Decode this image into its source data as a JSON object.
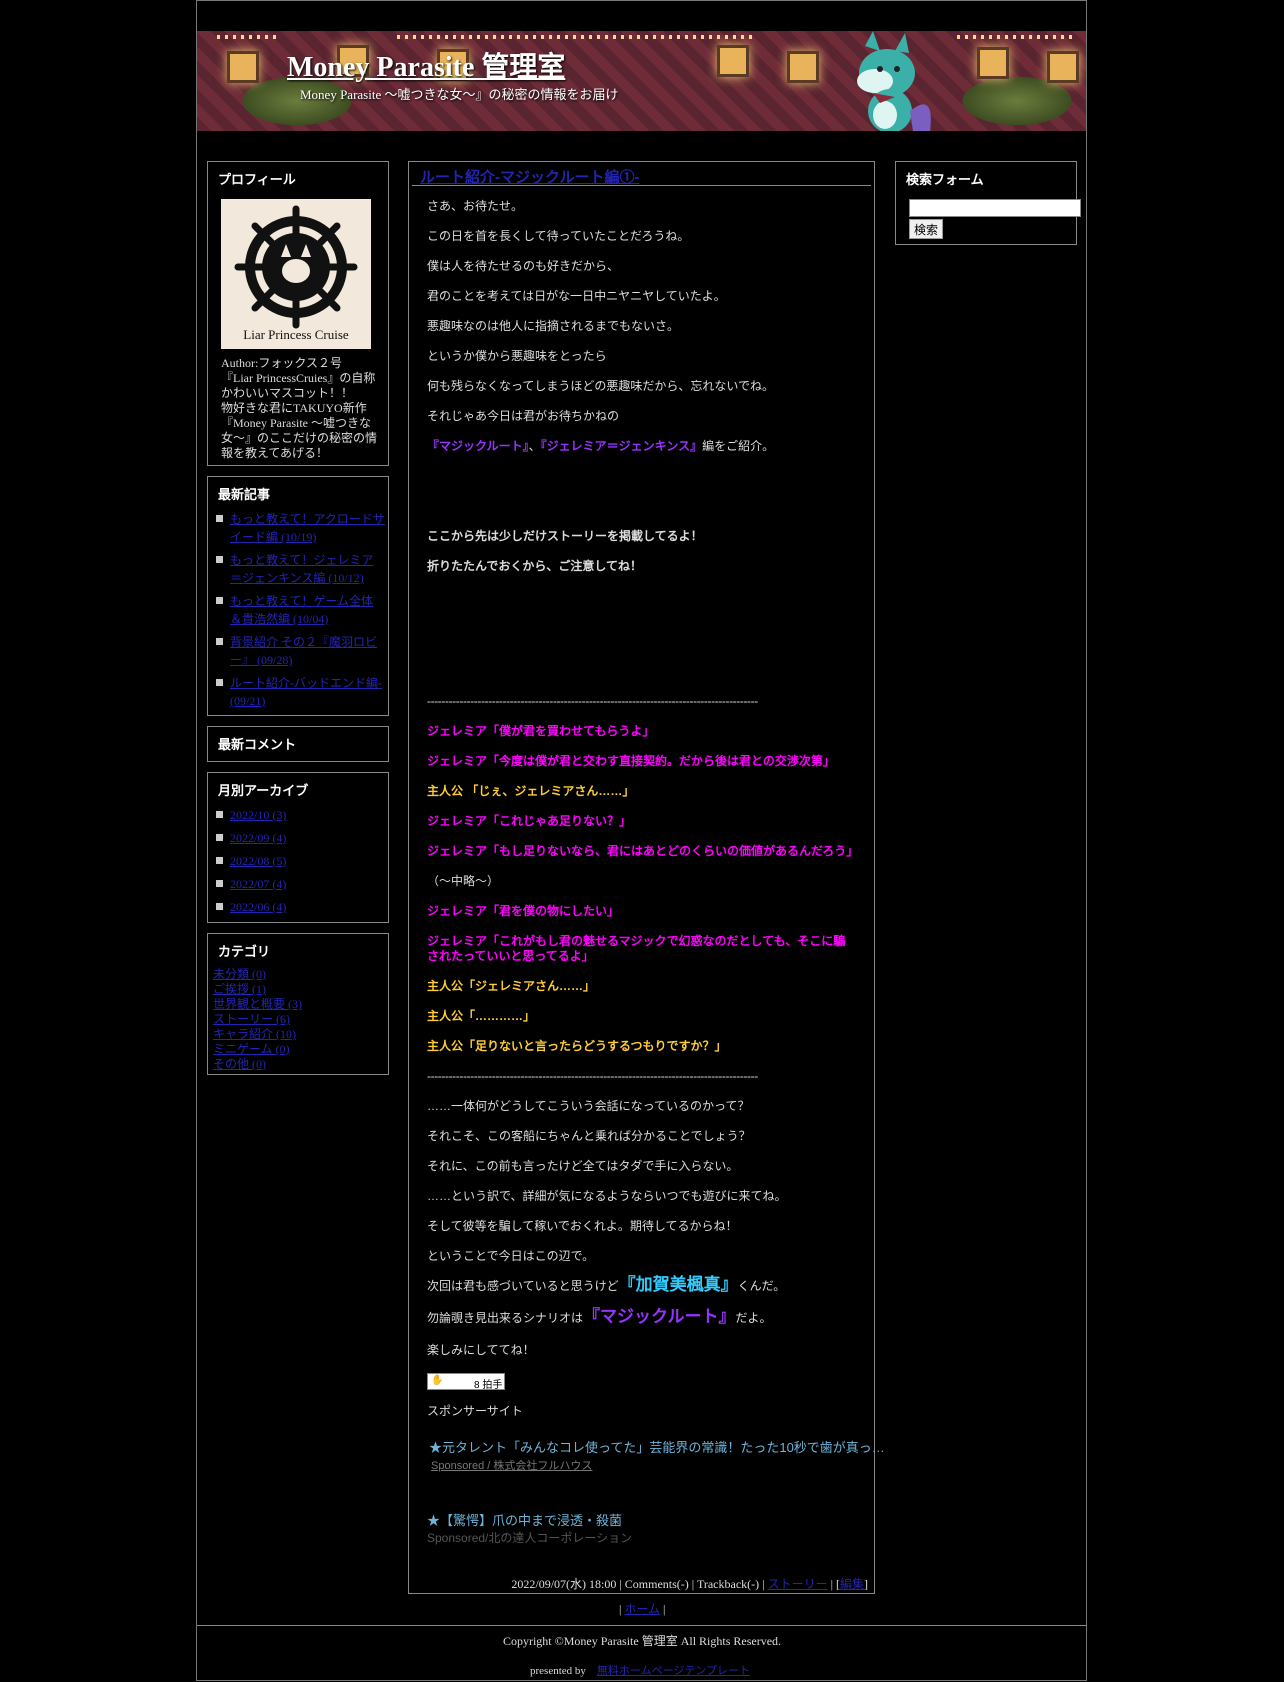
{
  "header": {
    "title": "Money Parasite 管理室",
    "description": "Money Parasite ～嘘つきな女～』の秘密の情報をお届け"
  },
  "profile": {
    "heading": "プロフィール",
    "logo_text": "Liar Princess Cruise",
    "bio": [
      "Author:フォックス２号",
      "『Liar PrincessCruies』の自称",
      "かわいいマスコット！！",
      "物好きな君にTAKUYO新作",
      "『Money Parasite ～嘘つきな",
      "女～』のここだけの秘密の情",
      "報を教えてあげる！"
    ]
  },
  "recent_posts": {
    "heading": "最新記事",
    "items": [
      [
        "もっと教えて！アクロードサ",
        "イード編 (10/19)"
      ],
      [
        "もっと教えて！ジェレミア",
        "＝ジェンキンス編 (10/12)"
      ],
      [
        "もっと教えて！ゲーム全体",
        "＆貴浩然編 (10/04)"
      ],
      [
        "背景紹介 その２『魔羽ロビ",
        "ー』 (09/28)"
      ],
      [
        "ルート紹介-バッドエンド編-",
        "(09/21)"
      ]
    ]
  },
  "recent_comments": {
    "heading": "最新コメント"
  },
  "archives": {
    "heading": "月別アーカイブ",
    "items": [
      "2022/10 (3)",
      "2022/09 (4)",
      "2022/08 (5)",
      "2022/07 (4)",
      "2022/06 (4)"
    ]
  },
  "categories": {
    "heading": "カテゴリ",
    "items": [
      "未分類 (0)",
      "ご挨拶 (1)",
      "世界観と概要 (3)",
      "ストーリー (6)",
      "キャラ紹介 (10)",
      "ミニゲーム (0)",
      "その他 (0)"
    ]
  },
  "search": {
    "heading": "検索フォーム",
    "button": "検索",
    "value": ""
  },
  "entry": {
    "title": "ルート紹介-マジックルート編①-",
    "intro": [
      "さあ、お待たせ。",
      "この日を首を長くして待っていたことだろうね。",
      "僕は人を待たせるのも好きだから、",
      "君のことを考えては日がな一日中ニヤニヤしていたよ。",
      "悪趣味なのは他人に指摘されるまでもないさ。",
      "というか僕から悪趣味をとったら",
      "何も残らなくなってしまうほどの悪趣味だから、忘れないでね。",
      "それじゃあ今日は君がお待ちかねの"
    ],
    "route_line": {
      "a": "『マジックルート』",
      "sep": "、",
      "b": "『ジェレミア＝ジェンキンス』",
      "tail": "編をご紹介。"
    },
    "warn1": "ここから先は少しだけストーリーを掲載してるよ！",
    "warn2": "折りたたんでおくから、ご注意してね！",
    "dash": "--------------------------------------------------------------------------------------------",
    "dialogue": [
      {
        "c": "mag",
        "t": "ジェレミア「僕が君を買わせてもらうよ」"
      },
      {
        "c": "mag",
        "t": "ジェレミア「今度は僕が君と交わす直接契約。だから後は君との交渉次第」"
      },
      {
        "c": "yel",
        "t": "主人公 「じぇ、ジェレミアさん……」"
      },
      {
        "c": "mag",
        "t": "ジェレミア「これじゃあ足りない？」"
      },
      {
        "c": "mag",
        "t": "ジェレミア「もし足りないなら、君にはあとどのくらいの価値があるんだろう」"
      },
      {
        "c": "plain",
        "t": "（～中略～）"
      },
      {
        "c": "mag",
        "t": "ジェレミア「君を僕の物にしたい」"
      },
      {
        "c": "mag",
        "t": "ジェレミア「これがもし君の魅せるマジックで幻惑なのだとしても、そこに騙"
      },
      {
        "c": "mag",
        "t": "されたっていいと思ってるよ」"
      },
      {
        "c": "yel",
        "t": "主人公「ジェレミアさん……」"
      },
      {
        "c": "yel",
        "t": "主人公「…………」"
      },
      {
        "c": "yel",
        "t": "主人公「足りないと言ったらどうするつもりですか？」"
      }
    ],
    "outro": [
      "……一体何がどうしてこういう会話になっているのかって？",
      "それこそ、この客船にちゃんと乗れば分かることでしょう？",
      "それに、この前も言ったけど全てはタダで手に入らない。",
      "……という訳で、詳細が気になるようならいつでも遊びに来てね。",
      "そして彼等を騙して稼いでおくれよ。期待してるからね！",
      "ということで今日はこの辺で。"
    ],
    "next1": {
      "pre": "次回は君も感づいていると思うけど",
      "em": "『加賀美楓真』",
      "post": "くんだ。"
    },
    "next2": {
      "pre": "勿論覗き見出来るシナリオは",
      "em": "『マジックルート』",
      "post": "だよ。"
    },
    "closing": "楽しみにしててね！",
    "clap_label": "8 拍手",
    "sponsor_label": "スポンサーサイト",
    "ad1": "★元タレント「みんなコレ使ってた」芸能界の常識！たった10秒で歯が真っ…",
    "ad1_sub": "Sponsored / 株式会社フルハウス",
    "ad2": "★【驚愕】爪の中まで浸透・殺菌",
    "ad2_sub": "Sponsored/北の達人コーポレーション",
    "meta_text": "2022/09/07(水) 18:00 | Comments(-) | Trackback(-) | ",
    "meta_cat": "ストーリー",
    "meta_sep": " | [",
    "meta_edit": "編集",
    "meta_end": "]"
  },
  "nav": {
    "home": "ホーム"
  },
  "footer": {
    "copyright": "Copyright ©Money Parasite 管理室 All Rights Reserved.",
    "presented_by": "presented by",
    "template_link": "無料ホームページテンプレート"
  }
}
